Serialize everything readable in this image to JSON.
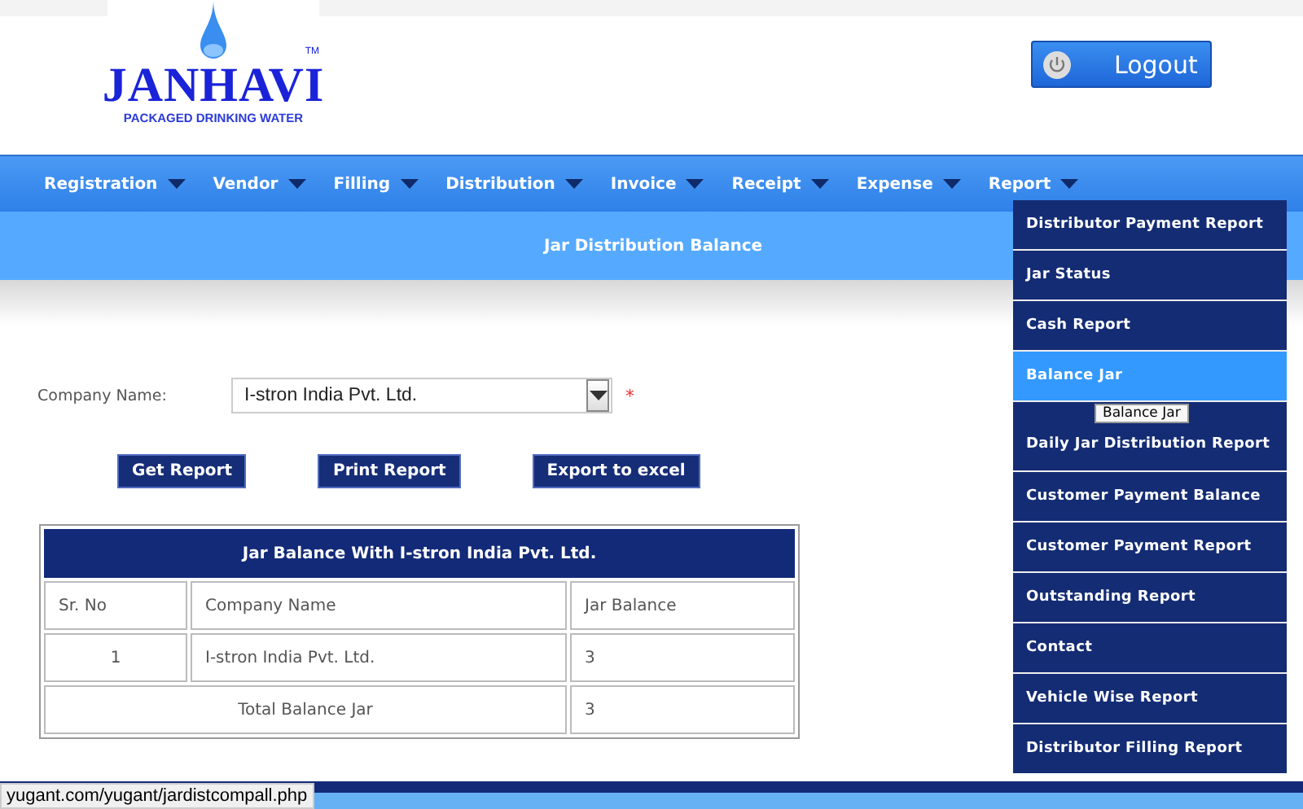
{
  "logo": {
    "name": "JANHAVI",
    "trademark": "TM",
    "tagline": "PACKAGED DRINKING WATER"
  },
  "logout": {
    "label": "Logout"
  },
  "nav": [
    {
      "label": "Registration"
    },
    {
      "label": "Vendor"
    },
    {
      "label": "Filling"
    },
    {
      "label": "Distribution"
    },
    {
      "label": "Invoice"
    },
    {
      "label": "Receipt"
    },
    {
      "label": "Expense"
    },
    {
      "label": "Report",
      "menu": [
        {
          "label": "Distributor Payment Report",
          "selected": false
        },
        {
          "label": "Jar Status",
          "selected": false
        },
        {
          "label": "Cash Report",
          "selected": false
        },
        {
          "label": "Balance Jar",
          "selected": true
        },
        {
          "label": "Daily Jar Distribution Report",
          "selected": false
        },
        {
          "label": "Customer Payment Balance",
          "selected": false
        },
        {
          "label": "Customer Payment Report",
          "selected": false
        },
        {
          "label": "Outstanding Report",
          "selected": false
        },
        {
          "label": "Contact",
          "selected": false
        },
        {
          "label": "Vehicle Wise Report",
          "selected": false
        },
        {
          "label": "Distributor Filling Report",
          "selected": false
        }
      ]
    }
  ],
  "tooltip": "Balance Jar",
  "page_title": "Jar Distribution Balance",
  "form": {
    "label": "Company Name:",
    "value": "I-stron India Pvt. Ltd.",
    "required_mark": "*"
  },
  "buttons": [
    "Get Report",
    "Print Report",
    "Export to excel"
  ],
  "table": {
    "title": "Jar Balance With I-stron India Pvt. Ltd.",
    "columns": [
      "Sr. No",
      "Company Name",
      "Jar Balance"
    ],
    "rows": [
      [
        "1",
        "I-stron India Pvt. Ltd.",
        "3"
      ]
    ],
    "total": {
      "label": "Total Balance Jar",
      "value": "3"
    }
  },
  "status_url": "yugant.com/yugant/jardistcompall.php"
}
